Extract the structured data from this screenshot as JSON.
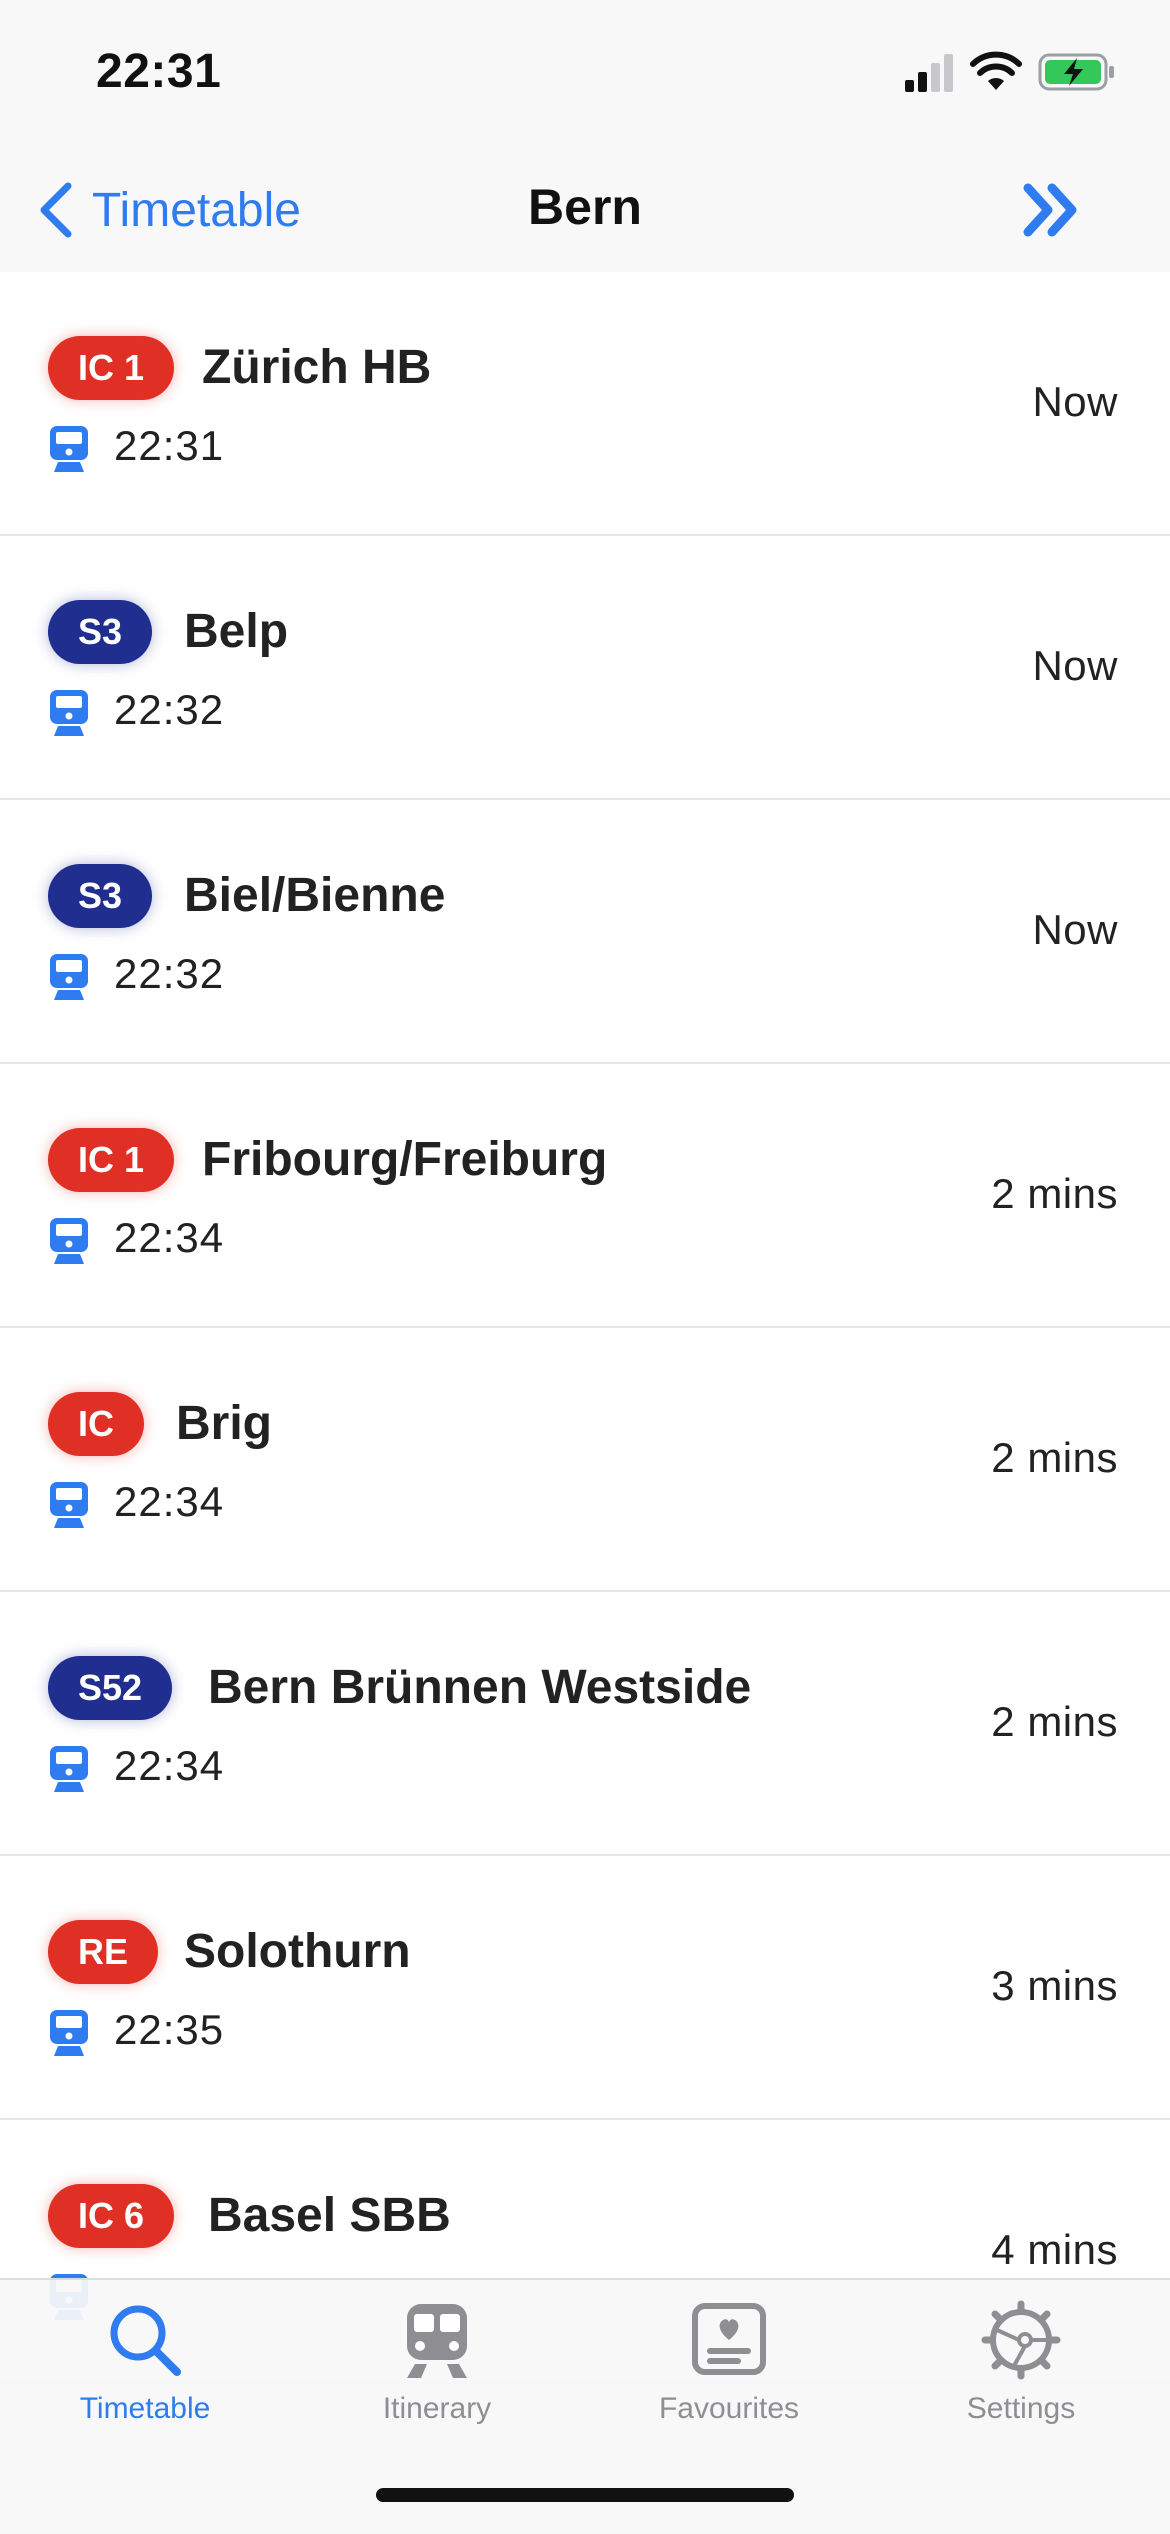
{
  "status_bar": {
    "time": "22:31"
  },
  "nav": {
    "back_label": "Timetable",
    "title": "Bern"
  },
  "departures": [
    {
      "line": "IC 1",
      "line_color": "#e02f24",
      "destination": "Zürich HB",
      "time": "22:31",
      "eta": "Now"
    },
    {
      "line": "S3",
      "line_color": "#1f2e8f",
      "destination": "Belp",
      "time": "22:32",
      "eta": "Now"
    },
    {
      "line": "S3",
      "line_color": "#1f2e8f",
      "destination": "Biel/Bienne",
      "time": "22:32",
      "eta": "Now"
    },
    {
      "line": "IC 1",
      "line_color": "#e02f24",
      "destination": "Fribourg/Freiburg",
      "time": "22:34",
      "eta": "2 mins"
    },
    {
      "line": "IC",
      "line_color": "#e02f24",
      "destination": "Brig",
      "time": "22:34",
      "eta": "2 mins"
    },
    {
      "line": "S52",
      "line_color": "#1f2e8f",
      "destination": "Bern Brünnen Westside",
      "time": "22:34",
      "eta": "2 mins"
    },
    {
      "line": "RE",
      "line_color": "#e02f24",
      "destination": "Solothurn",
      "time": "22:35",
      "eta": "3 mins"
    },
    {
      "line": "IC 6",
      "line_color": "#e02f24",
      "destination": "Basel SBB",
      "time": "",
      "eta": "4 mins"
    }
  ],
  "tabs": [
    {
      "label": "Timetable",
      "icon": "search-icon",
      "active": true
    },
    {
      "label": "Itinerary",
      "icon": "train-icon",
      "active": false
    },
    {
      "label": "Favourites",
      "icon": "favourites-icon",
      "active": false
    },
    {
      "label": "Settings",
      "icon": "gear-icon",
      "active": false
    }
  ],
  "colors": {
    "accent": "#2f7bf0",
    "line_red": "#e02f24",
    "line_blue": "#1f2e8f",
    "inactive": "#8e8e93"
  }
}
